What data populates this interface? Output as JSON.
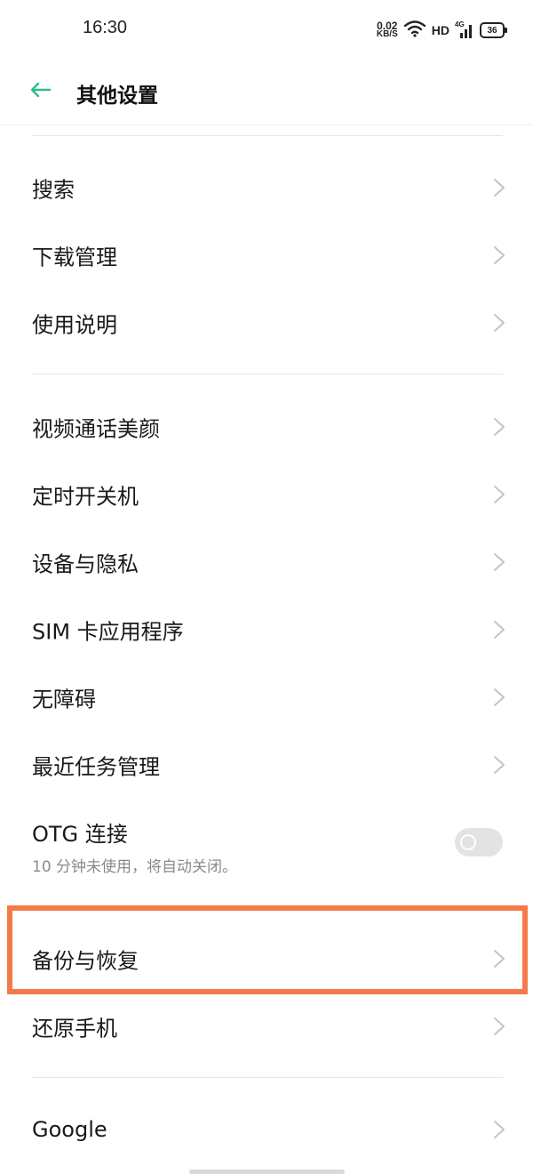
{
  "status_bar": {
    "time": "16:30",
    "net_speed_value": "0.02",
    "net_speed_unit": "KB/S",
    "hd": "HD",
    "network": "4G",
    "battery": "36"
  },
  "header": {
    "back_icon": "arrow-left-icon",
    "title": "其他设置"
  },
  "groups": [
    {
      "items": [
        {
          "label": "搜索"
        },
        {
          "label": "下载管理"
        },
        {
          "label": "使用说明"
        }
      ]
    },
    {
      "items": [
        {
          "label": "视频通话美颜"
        },
        {
          "label": "定时开关机"
        },
        {
          "label": "设备与隐私"
        },
        {
          "label": "SIM 卡应用程序"
        },
        {
          "label": "无障碍"
        },
        {
          "label": "最近任务管理"
        }
      ]
    }
  ],
  "otg": {
    "label": "OTG 连接",
    "sub": "10 分钟未使用，将自动关闭。",
    "enabled": false
  },
  "backup_group": {
    "items": [
      {
        "label": "备份与恢复"
      },
      {
        "label": "还原手机"
      }
    ]
  },
  "google_group": {
    "items": [
      {
        "label": "Google"
      }
    ]
  },
  "colors": {
    "accent": "#2bbf87",
    "highlight": "#f37b4a",
    "chevron": "#c4c4c4"
  }
}
